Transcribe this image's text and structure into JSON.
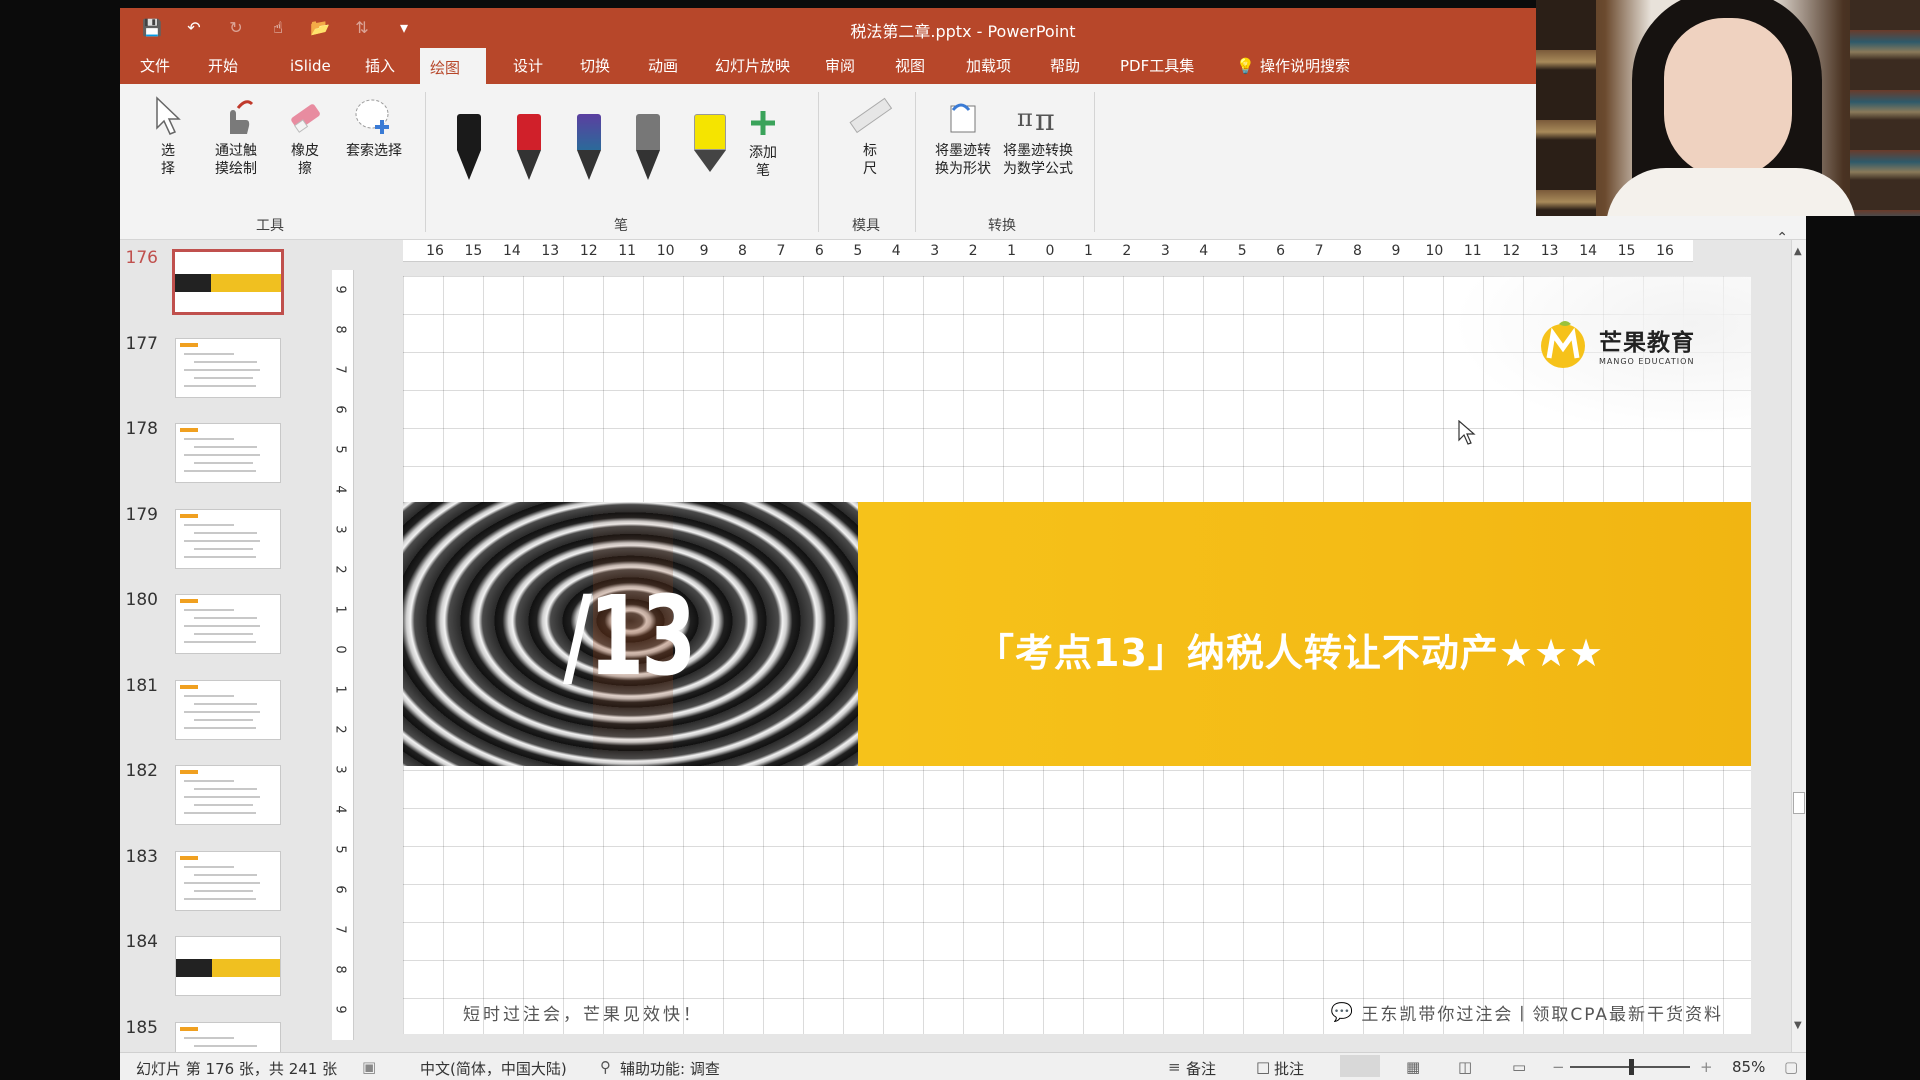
{
  "window": {
    "title": "税法第二章.pptx  -  PowerPoint"
  },
  "tabs": [
    {
      "label": "文件"
    },
    {
      "label": "开始"
    },
    {
      "label": "iSlide"
    },
    {
      "label": "插入"
    },
    {
      "label": "绘图",
      "active": true
    },
    {
      "label": "设计"
    },
    {
      "label": "切换"
    },
    {
      "label": "动画"
    },
    {
      "label": "幻灯片放映"
    },
    {
      "label": "审阅"
    },
    {
      "label": "视图"
    },
    {
      "label": "加载项"
    },
    {
      "label": "帮助"
    },
    {
      "label": "PDF工具集"
    },
    {
      "label": "操作说明搜索"
    }
  ],
  "ribbon": {
    "tools": {
      "select": "选\n择",
      "touch_draw": "通过触\n摸绘制",
      "eraser": "橡皮\n擦",
      "lasso": "套索选择",
      "group_label": "工具"
    },
    "pens": {
      "add_pen": "添加\n笔",
      "group_label": "笔",
      "colors": [
        "#1a1a1a",
        "#d0202a",
        "#3a3f8f",
        "#777777",
        "#f5e400"
      ]
    },
    "stencils": {
      "ruler": "标\n尺",
      "group_label": "模具"
    },
    "convert": {
      "ink_to_shape": "将墨迹转\n换为形状",
      "ink_to_math": "将墨迹转换\n为数学公式",
      "group_label": "转换"
    }
  },
  "thumbnails": [
    {
      "number": "176",
      "kind": "section",
      "selected": true
    },
    {
      "number": "177",
      "kind": "content"
    },
    {
      "number": "178",
      "kind": "content"
    },
    {
      "number": "179",
      "kind": "content"
    },
    {
      "number": "180",
      "kind": "content"
    },
    {
      "number": "181",
      "kind": "content"
    },
    {
      "number": "182",
      "kind": "content"
    },
    {
      "number": "183",
      "kind": "content"
    },
    {
      "number": "184",
      "kind": "section"
    },
    {
      "number": "185",
      "kind": "content"
    }
  ],
  "hruler": [
    "16",
    "15",
    "14",
    "13",
    "12",
    "11",
    "10",
    "9",
    "8",
    "7",
    "6",
    "5",
    "4",
    "3",
    "2",
    "1",
    "0",
    "1",
    "2",
    "3",
    "4",
    "5",
    "6",
    "7",
    "8",
    "9",
    "10",
    "11",
    "12",
    "13",
    "14",
    "15",
    "16"
  ],
  "vruler": [
    "9",
    "8",
    "7",
    "6",
    "5",
    "4",
    "3",
    "2",
    "1",
    "0",
    "1",
    "2",
    "3",
    "4",
    "5",
    "6",
    "7",
    "8",
    "9"
  ],
  "slide": {
    "logo_cn": "芒果教育",
    "logo_en": "MANGO EDUCATION",
    "section_number": "/13",
    "heading": "「考点13」纳税人转让不动产★★★",
    "footer_left": "短时过注会，芒果见效快！",
    "footer_right": "王东凯带你过注会丨领取CPA最新干货资料"
  },
  "statusbar": {
    "slide_info": "幻灯片 第 176 张，共 241 张",
    "language": "中文(简体，中国大陆)",
    "accessibility": "辅助功能: 调查",
    "notes": "备注",
    "comments": "批注",
    "zoom": "85%"
  },
  "colors": {
    "accent": "#b7472a",
    "selection": "#c0504d",
    "banner_yellow": "#f4bb16"
  }
}
